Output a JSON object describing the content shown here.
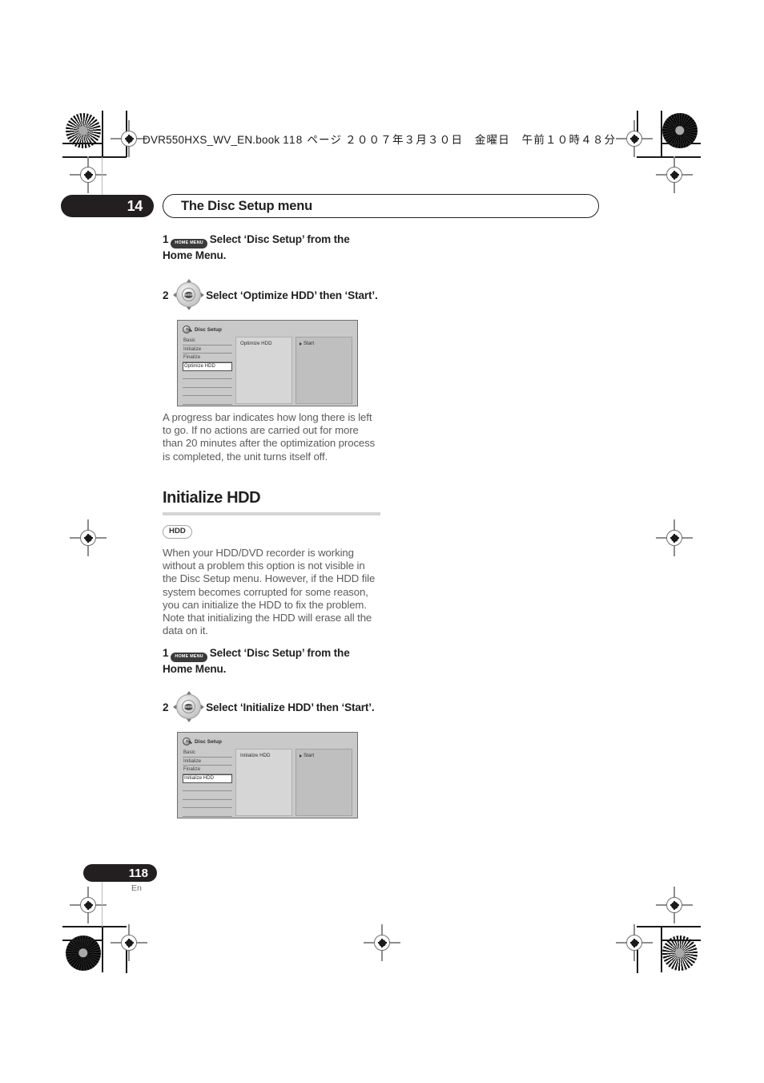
{
  "print_header": {
    "book_file": "DVR550HXS_WV_EN.book",
    "page_marker": "118 ページ",
    "date_jp": "２００７年３月３０日　金曜日　午前１０時４８分"
  },
  "chapter": {
    "number": "14",
    "title": "The Disc Setup menu"
  },
  "section_optimize": {
    "steps": [
      {
        "num": "1",
        "key_icon": "home-menu-key-icon",
        "key_label": "HOME MENU",
        "text": "Select ‘Disc Setup’ from the Home Menu."
      },
      {
        "num": "2",
        "key_icon": "enter-jog-wheel-icon",
        "key_label": "ENTER",
        "text": "Select ‘Optimize HDD’ then ‘Start’."
      }
    ],
    "screen": {
      "title": "Disc Setup",
      "title_icon": "disc-setup-icon",
      "menu_items": [
        "Basic",
        "Initialize",
        "Finalize",
        "Optimize HDD"
      ],
      "selected_item": "Optimize HDD",
      "blank_rows": 4,
      "middle_label": "Optimize HDD",
      "option_label": "Start",
      "option_caret": "caret-right-icon"
    },
    "paragraph": "A progress bar indicates how long there is left to go. If no actions are carried out for more than 20 minutes after the optimization process is completed, the unit turns itself off."
  },
  "section_initialize": {
    "heading": "Initialize HDD",
    "media_badge": "HDD",
    "paragraph": "When your HDD/DVD recorder is working without a problem this option is not visible in the Disc Setup menu. However, if the HDD file system becomes corrupted for some reason, you can initialize the HDD to fix the problem. Note that initializing the HDD will erase all the data on it.",
    "steps": [
      {
        "num": "1",
        "key_icon": "home-menu-key-icon",
        "key_label": "HOME MENU",
        "text": "Select ‘Disc Setup’ from the Home Menu."
      },
      {
        "num": "2",
        "key_icon": "enter-jog-wheel-icon",
        "key_label": "ENTER",
        "text": "Select ‘Initialize HDD’ then ‘Start’."
      }
    ],
    "screen": {
      "title": "Disc Setup",
      "title_icon": "disc-setup-icon",
      "menu_items": [
        "Basic",
        "Initialize",
        "Finalize",
        "Initialize HDD"
      ],
      "selected_item": "Initialize HDD",
      "blank_rows": 4,
      "middle_label": "Initialize HDD",
      "option_label": "Start",
      "option_caret": "caret-right-icon"
    }
  },
  "footer": {
    "page_number": "118",
    "language": "En"
  },
  "colors": {
    "ink": "#231f20",
    "body_text": "#5b5b5b",
    "rule": "#d4d4d4",
    "osd_bg": "#c9c9c9"
  }
}
